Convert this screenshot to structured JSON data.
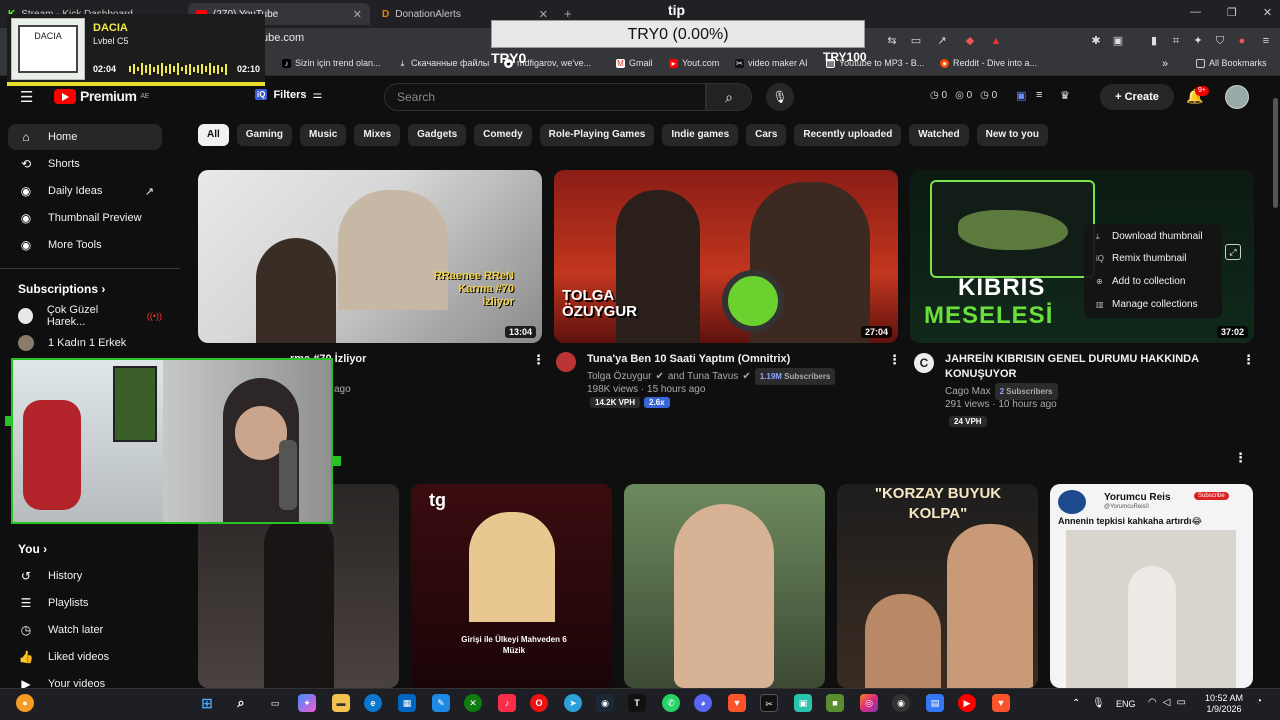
{
  "browser": {
    "tabs": [
      {
        "label": "Stream - Kick Dashboard",
        "icon": "kick-icon"
      },
      {
        "label": "(270) YouTube",
        "icon": "youtube-icon"
      },
      {
        "label": "DonationAlerts",
        "icon": "donationalerts-icon"
      }
    ],
    "url": "ube.com",
    "bookmarks": [
      "Sizin için trend olan...",
      "Скачанные файлы",
      "mdfigarov, we've...",
      "Gmail",
      "Yout.com",
      "video maker AI",
      "Youtube to MP3 - B...",
      "Reddit - Dive into a..."
    ],
    "all_bookmarks": "All Bookmarks"
  },
  "now_playing": {
    "art_label": "DACIA",
    "title": "DACIA",
    "subtitle": "Lvbel C5",
    "time_current": "02:04",
    "time_total": "02:10"
  },
  "tip_overlay": {
    "label": "tip",
    "amount": "TRY0 (0.00%)",
    "min": "TRY0",
    "max": "TRY100"
  },
  "header": {
    "logo": "Premium",
    "logo_sup": "AE",
    "filters": "Filters",
    "search_placeholder": "Search",
    "counters": [
      "0",
      "0",
      "0"
    ],
    "create": "Create",
    "notifications": "9+"
  },
  "sidebar": {
    "main": [
      {
        "label": "Home",
        "icon": "home-icon"
      },
      {
        "label": "Shorts",
        "icon": "shorts-icon"
      },
      {
        "label": "Daily Ideas",
        "icon": "ideas-icon"
      },
      {
        "label": "Thumbnail Preview",
        "icon": "thumbnail-icon"
      },
      {
        "label": "More Tools",
        "icon": "tools-icon"
      }
    ],
    "subscriptions_title": "Subscriptions",
    "subscriptions": [
      "Çok Güzel Harek...",
      "1 Kadın 1 Erkek"
    ],
    "you_title": "You",
    "you": [
      {
        "label": "History",
        "icon": "history-icon"
      },
      {
        "label": "Playlists",
        "icon": "playlists-icon"
      },
      {
        "label": "Watch later",
        "icon": "clock-icon"
      },
      {
        "label": "Liked videos",
        "icon": "like-icon"
      },
      {
        "label": "Your videos",
        "icon": "video-icon"
      }
    ]
  },
  "chips": [
    "All",
    "Gaming",
    "Music",
    "Mixes",
    "Gadgets",
    "Comedy",
    "Role-Playing Games",
    "Indie games",
    "Cars",
    "Recently uploaded",
    "Watched",
    "New to you"
  ],
  "videos": [
    {
      "duration": "13:04",
      "title_partial": "rma #70 İzliyor",
      "meta_partial": "ago",
      "thumb_text": "RRaenee RReN Karma #70 İzliyor"
    },
    {
      "duration": "27:04",
      "title": "Tuna'ya Ben 10 Saati Yaptım (Omnitrix)",
      "channel": "Tolga Özuygur",
      "collab": "and Tuna Tavus",
      "subs": "1.19M",
      "subs_suffix": "Subscribers",
      "views": "198K views · 15 hours ago",
      "vph": "14.2K VPH",
      "ratio": "2.6x",
      "thumb_text": "TOLGA ÖZUYGUR"
    },
    {
      "duration": "37:02",
      "title": "JAHREİN KIBRISIN GENEL DURUMU HAKKINDA KONUŞUYOR",
      "channel": "Cago Max",
      "subs": "2",
      "subs_suffix": "Subscribers",
      "views": "291 views · 10 hours ago",
      "vph": "24 VPH",
      "thumb_text1": "KIBRIS",
      "thumb_text2": "MESELESİ"
    }
  ],
  "context_menu": [
    "Download thumbnail",
    "Remix thumbnail",
    "Add to collection",
    "Manage collections"
  ],
  "shorts": [
    {
      "thumb_text": ""
    },
    {
      "thumb_text": "Girişi ile Ülkeyi Mahveden 6 Müzik",
      "badge": "tg"
    },
    {
      "thumb_text": ""
    },
    {
      "thumb_text": "\"KORZAY BUYUK KOLPA\""
    },
    {
      "channel": "Yorumcu Reis",
      "handle": "@YorumcuReis0",
      "caption": "Annenin tepkisi kahkaha artırdı😂",
      "subscribe": "Subscribe"
    }
  ],
  "taskbar": {
    "lang": "ENG",
    "time": "10:52 AM",
    "date": "1/9/2026"
  }
}
